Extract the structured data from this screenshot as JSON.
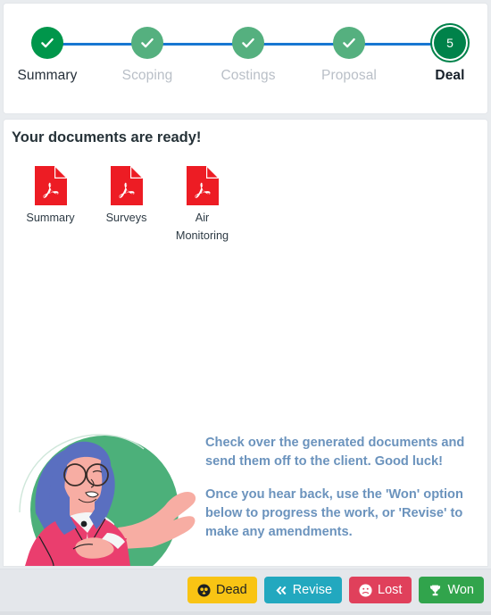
{
  "stepper": {
    "steps": [
      {
        "label": "Summary",
        "state": "done-first",
        "icon": "check-icon",
        "number": "1"
      },
      {
        "label": "Scoping",
        "state": "done",
        "icon": "check-icon",
        "number": "2"
      },
      {
        "label": "Costings",
        "state": "done",
        "icon": "check-icon",
        "number": "3"
      },
      {
        "label": "Proposal",
        "state": "done",
        "icon": "check-icon",
        "number": "4"
      },
      {
        "label": "Deal",
        "state": "current",
        "icon": "step-number",
        "number": "5"
      }
    ]
  },
  "main": {
    "heading": "Your documents are ready!",
    "documents": [
      {
        "label": "Summary",
        "icon": "pdf-file-icon"
      },
      {
        "label": "Surveys",
        "icon": "pdf-file-icon"
      },
      {
        "label": "Air Monitoring",
        "icon": "pdf-file-icon"
      }
    ],
    "callout": {
      "paragraph1": "Check over the generated documents and send them off to the client. Good luck!",
      "paragraph2": "Once you hear back, use the 'Won' option below to progress the work, or 'Revise' to make any amendments."
    },
    "illustration": "woman-presenting-illustration"
  },
  "footer": {
    "buttons": [
      {
        "label": "Dead",
        "icon": "skull-icon",
        "style": "dead"
      },
      {
        "label": "Revise",
        "icon": "double-chevron-left-icon",
        "style": "revise"
      },
      {
        "label": "Lost",
        "icon": "frowning-face-icon",
        "style": "lost"
      },
      {
        "label": "Won",
        "icon": "trophy-icon",
        "style": "won"
      }
    ]
  },
  "colors": {
    "step_done_first": "#00964b",
    "step_done": "#55b07f",
    "step_current": "#00824a",
    "connector": "#1877d2",
    "pdf_red": "#ed1c24",
    "callout_text": "#6b93bd",
    "btn_dead": "#f9c414",
    "btn_revise": "#22a8bf",
    "btn_lost": "#e0405b",
    "btn_won": "#31a44c",
    "footer_bg": "#e4e7eb"
  }
}
